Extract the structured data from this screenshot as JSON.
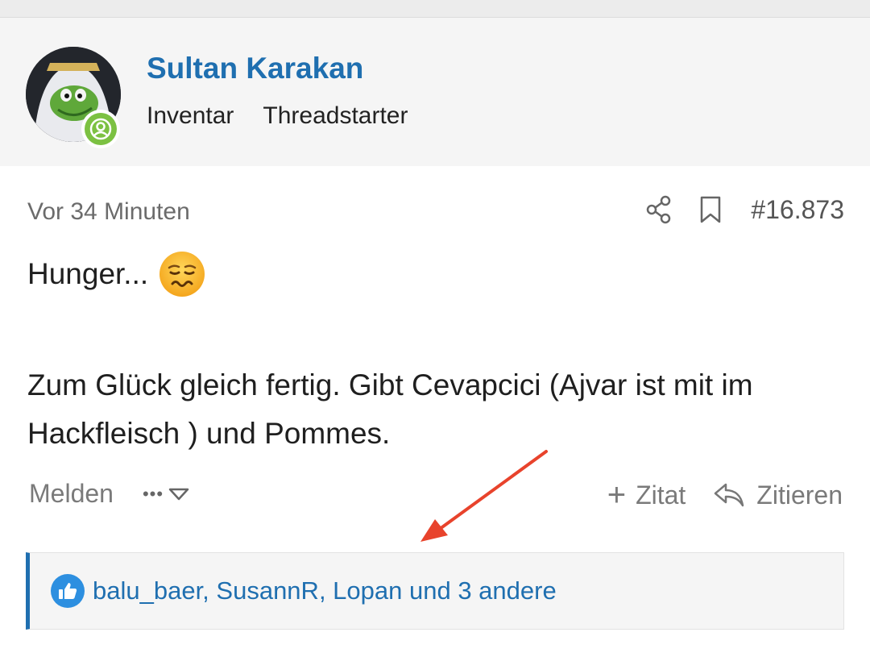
{
  "post": {
    "author": "Sultan Karakan",
    "badges": [
      "Inventar",
      "Threadstarter"
    ],
    "timestamp": "Vor 34 Minuten",
    "post_number": "#16.873",
    "content_line1": "Hunger...",
    "content_para": "Zum Glück gleich fertig. Gibt Cevapcici (Ajvar ist mit im Hackfleisch ) und Pommes.",
    "emoji": "weary-face-emoji"
  },
  "footer": {
    "report_label": "Melden",
    "more_label": "•••",
    "add_quote_label": "Zitat",
    "quote_label": "Zitieren"
  },
  "reactions": {
    "likers_text": "balu_baer, SusannR, Lopan und 3 andere"
  },
  "colors": {
    "accent": "#1f6fb0",
    "online": "#7cc142",
    "like": "#2d8fe0",
    "annotation_arrow": "#e8432c"
  }
}
